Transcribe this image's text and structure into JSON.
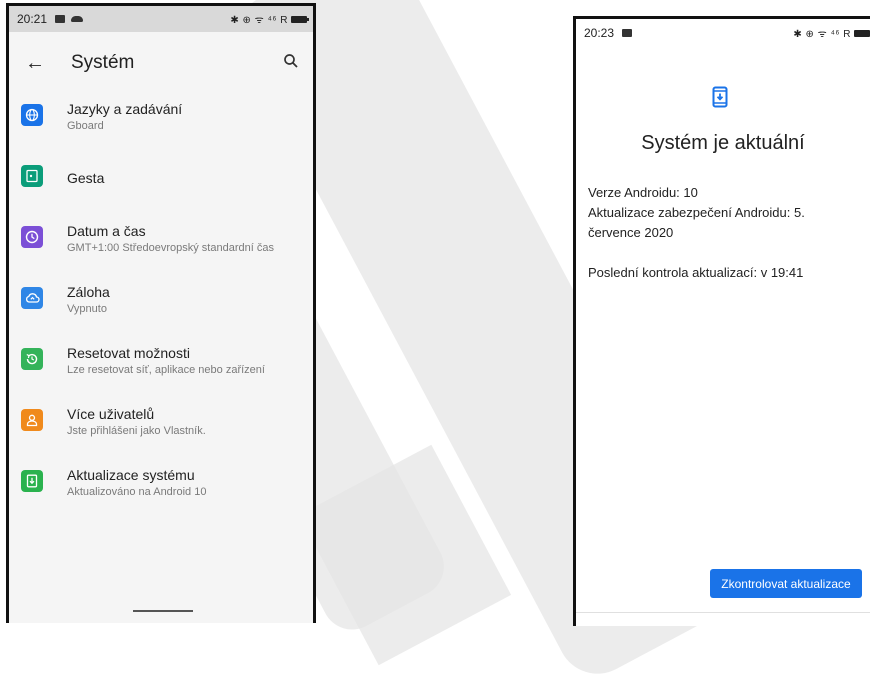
{
  "left_phone": {
    "status_time": "20:21",
    "status_right": "✱ ⊕ ᯤ ⁴⁶ R",
    "toolbar": {
      "back": "←",
      "title": "Systém"
    },
    "items": [
      {
        "title": "Jazyky a zadávání",
        "subtitle": "Gboard",
        "icon": "globe-icon",
        "color": "#1a73e8"
      },
      {
        "title": "Gesta",
        "subtitle": "",
        "icon": "gesture-icon",
        "color": "#0b9d7a"
      },
      {
        "title": "Datum a čas",
        "subtitle": "GMT+1:00 Středoevropský standardní čas",
        "icon": "clock-icon",
        "color": "#7b4fd6"
      },
      {
        "title": "Záloha",
        "subtitle": "Vypnuto",
        "icon": "cloud-backup-icon",
        "color": "#2f86e6"
      },
      {
        "title": "Resetovat možnosti",
        "subtitle": "Lze resetovat síť, aplikace nebo zařízení",
        "icon": "reset-icon",
        "color": "#34b35a"
      },
      {
        "title": "Více uživatelů",
        "subtitle": "Jste přihlášeni jako Vlastník.",
        "icon": "user-icon",
        "color": "#f08a1c"
      },
      {
        "title": "Aktualizace systému",
        "subtitle": "Aktualizováno na Android 10",
        "icon": "system-update-icon",
        "color": "#2ab24e"
      }
    ]
  },
  "right_phone": {
    "status_time": "20:23",
    "status_right": "✱ ⊕ ᯤ ⁴⁶ R",
    "title": "Systém je aktuální",
    "android_version": "Verze Androidu: 10",
    "security_update": "Aktualizace zabezpečení Androidu: 5. července 2020",
    "last_check": "Poslední kontrola aktualizací: v 19:41",
    "button_label": "Zkontrolovat aktualizace",
    "accent": "#1a73e8"
  }
}
